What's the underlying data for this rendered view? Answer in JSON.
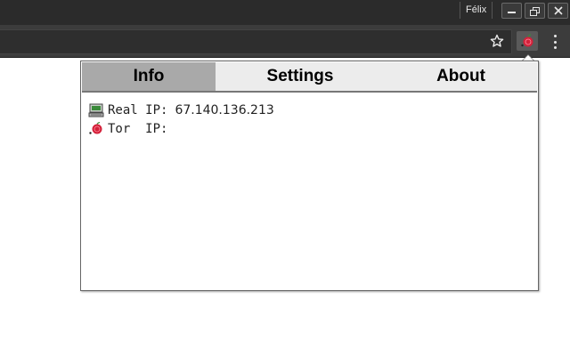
{
  "window": {
    "profile_name": "Félix",
    "buttons": {
      "minimize": "minimize-icon",
      "maximize": "restore-icon",
      "close": "close-icon"
    }
  },
  "toolbar": {
    "bookmark_icon": "star-icon",
    "extension_icon": "tor-onion-icon",
    "menu_icon": "kebab-menu-icon"
  },
  "popup": {
    "tabs": [
      {
        "label": "Info",
        "active": true
      },
      {
        "label": "Settings",
        "active": false
      },
      {
        "label": "About",
        "active": false
      }
    ],
    "info": {
      "real_ip_label": "Real IP:",
      "real_ip_value": "67.140.136.213",
      "tor_ip_label": "Tor  IP:",
      "tor_ip_value": ""
    }
  },
  "colors": {
    "active_tab": "#a9a9a9",
    "tab_bar": "#ececec",
    "onion_red": "#d4213a"
  }
}
